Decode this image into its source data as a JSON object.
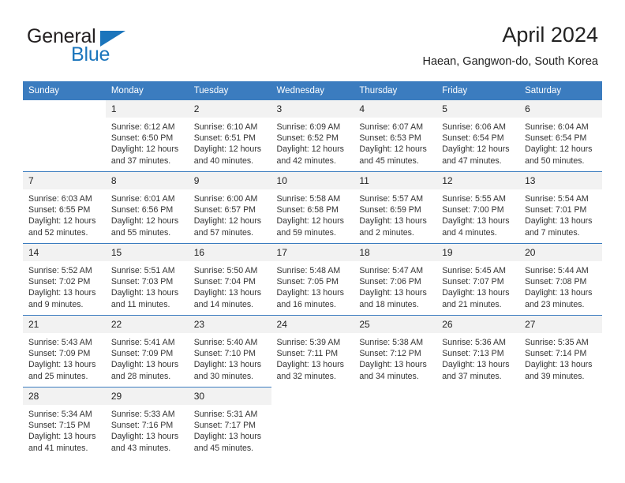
{
  "brand": {
    "name_part1": "General",
    "name_part2": "Blue",
    "flag_icon": "triangle-flag-icon"
  },
  "header": {
    "title": "April 2024",
    "location": "Haean, Gangwon-do, South Korea"
  },
  "colors": {
    "header_blue": "#3b7cbf",
    "brand_blue": "#1b75bc",
    "daynum_bg": "#f2f2f2",
    "text": "#222222"
  },
  "weekday_headers": [
    "Sunday",
    "Monday",
    "Tuesday",
    "Wednesday",
    "Thursday",
    "Friday",
    "Saturday"
  ],
  "labels": {
    "sunrise": "Sunrise:",
    "sunset": "Sunset:",
    "daylight": "Daylight:"
  },
  "weeks": [
    {
      "days": [
        {
          "num": "",
          "blank": true,
          "sunrise": "",
          "sunset": "",
          "daylight_line1": "",
          "daylight_line2": ""
        },
        {
          "num": "1",
          "sunrise": "Sunrise: 6:12 AM",
          "sunset": "Sunset: 6:50 PM",
          "daylight_line1": "Daylight: 12 hours",
          "daylight_line2": "and 37 minutes."
        },
        {
          "num": "2",
          "sunrise": "Sunrise: 6:10 AM",
          "sunset": "Sunset: 6:51 PM",
          "daylight_line1": "Daylight: 12 hours",
          "daylight_line2": "and 40 minutes."
        },
        {
          "num": "3",
          "sunrise": "Sunrise: 6:09 AM",
          "sunset": "Sunset: 6:52 PM",
          "daylight_line1": "Daylight: 12 hours",
          "daylight_line2": "and 42 minutes."
        },
        {
          "num": "4",
          "sunrise": "Sunrise: 6:07 AM",
          "sunset": "Sunset: 6:53 PM",
          "daylight_line1": "Daylight: 12 hours",
          "daylight_line2": "and 45 minutes."
        },
        {
          "num": "5",
          "sunrise": "Sunrise: 6:06 AM",
          "sunset": "Sunset: 6:54 PM",
          "daylight_line1": "Daylight: 12 hours",
          "daylight_line2": "and 47 minutes."
        },
        {
          "num": "6",
          "sunrise": "Sunrise: 6:04 AM",
          "sunset": "Sunset: 6:54 PM",
          "daylight_line1": "Daylight: 12 hours",
          "daylight_line2": "and 50 minutes."
        }
      ]
    },
    {
      "days": [
        {
          "num": "7",
          "sunrise": "Sunrise: 6:03 AM",
          "sunset": "Sunset: 6:55 PM",
          "daylight_line1": "Daylight: 12 hours",
          "daylight_line2": "and 52 minutes."
        },
        {
          "num": "8",
          "sunrise": "Sunrise: 6:01 AM",
          "sunset": "Sunset: 6:56 PM",
          "daylight_line1": "Daylight: 12 hours",
          "daylight_line2": "and 55 minutes."
        },
        {
          "num": "9",
          "sunrise": "Sunrise: 6:00 AM",
          "sunset": "Sunset: 6:57 PM",
          "daylight_line1": "Daylight: 12 hours",
          "daylight_line2": "and 57 minutes."
        },
        {
          "num": "10",
          "sunrise": "Sunrise: 5:58 AM",
          "sunset": "Sunset: 6:58 PM",
          "daylight_line1": "Daylight: 12 hours",
          "daylight_line2": "and 59 minutes."
        },
        {
          "num": "11",
          "sunrise": "Sunrise: 5:57 AM",
          "sunset": "Sunset: 6:59 PM",
          "daylight_line1": "Daylight: 13 hours",
          "daylight_line2": "and 2 minutes."
        },
        {
          "num": "12",
          "sunrise": "Sunrise: 5:55 AM",
          "sunset": "Sunset: 7:00 PM",
          "daylight_line1": "Daylight: 13 hours",
          "daylight_line2": "and 4 minutes."
        },
        {
          "num": "13",
          "sunrise": "Sunrise: 5:54 AM",
          "sunset": "Sunset: 7:01 PM",
          "daylight_line1": "Daylight: 13 hours",
          "daylight_line2": "and 7 minutes."
        }
      ]
    },
    {
      "days": [
        {
          "num": "14",
          "sunrise": "Sunrise: 5:52 AM",
          "sunset": "Sunset: 7:02 PM",
          "daylight_line1": "Daylight: 13 hours",
          "daylight_line2": "and 9 minutes."
        },
        {
          "num": "15",
          "sunrise": "Sunrise: 5:51 AM",
          "sunset": "Sunset: 7:03 PM",
          "daylight_line1": "Daylight: 13 hours",
          "daylight_line2": "and 11 minutes."
        },
        {
          "num": "16",
          "sunrise": "Sunrise: 5:50 AM",
          "sunset": "Sunset: 7:04 PM",
          "daylight_line1": "Daylight: 13 hours",
          "daylight_line2": "and 14 minutes."
        },
        {
          "num": "17",
          "sunrise": "Sunrise: 5:48 AM",
          "sunset": "Sunset: 7:05 PM",
          "daylight_line1": "Daylight: 13 hours",
          "daylight_line2": "and 16 minutes."
        },
        {
          "num": "18",
          "sunrise": "Sunrise: 5:47 AM",
          "sunset": "Sunset: 7:06 PM",
          "daylight_line1": "Daylight: 13 hours",
          "daylight_line2": "and 18 minutes."
        },
        {
          "num": "19",
          "sunrise": "Sunrise: 5:45 AM",
          "sunset": "Sunset: 7:07 PM",
          "daylight_line1": "Daylight: 13 hours",
          "daylight_line2": "and 21 minutes."
        },
        {
          "num": "20",
          "sunrise": "Sunrise: 5:44 AM",
          "sunset": "Sunset: 7:08 PM",
          "daylight_line1": "Daylight: 13 hours",
          "daylight_line2": "and 23 minutes."
        }
      ]
    },
    {
      "days": [
        {
          "num": "21",
          "sunrise": "Sunrise: 5:43 AM",
          "sunset": "Sunset: 7:09 PM",
          "daylight_line1": "Daylight: 13 hours",
          "daylight_line2": "and 25 minutes."
        },
        {
          "num": "22",
          "sunrise": "Sunrise: 5:41 AM",
          "sunset": "Sunset: 7:09 PM",
          "daylight_line1": "Daylight: 13 hours",
          "daylight_line2": "and 28 minutes."
        },
        {
          "num": "23",
          "sunrise": "Sunrise: 5:40 AM",
          "sunset": "Sunset: 7:10 PM",
          "daylight_line1": "Daylight: 13 hours",
          "daylight_line2": "and 30 minutes."
        },
        {
          "num": "24",
          "sunrise": "Sunrise: 5:39 AM",
          "sunset": "Sunset: 7:11 PM",
          "daylight_line1": "Daylight: 13 hours",
          "daylight_line2": "and 32 minutes."
        },
        {
          "num": "25",
          "sunrise": "Sunrise: 5:38 AM",
          "sunset": "Sunset: 7:12 PM",
          "daylight_line1": "Daylight: 13 hours",
          "daylight_line2": "and 34 minutes."
        },
        {
          "num": "26",
          "sunrise": "Sunrise: 5:36 AM",
          "sunset": "Sunset: 7:13 PM",
          "daylight_line1": "Daylight: 13 hours",
          "daylight_line2": "and 37 minutes."
        },
        {
          "num": "27",
          "sunrise": "Sunrise: 5:35 AM",
          "sunset": "Sunset: 7:14 PM",
          "daylight_line1": "Daylight: 13 hours",
          "daylight_line2": "and 39 minutes."
        }
      ]
    },
    {
      "days": [
        {
          "num": "28",
          "sunrise": "Sunrise: 5:34 AM",
          "sunset": "Sunset: 7:15 PM",
          "daylight_line1": "Daylight: 13 hours",
          "daylight_line2": "and 41 minutes."
        },
        {
          "num": "29",
          "sunrise": "Sunrise: 5:33 AM",
          "sunset": "Sunset: 7:16 PM",
          "daylight_line1": "Daylight: 13 hours",
          "daylight_line2": "and 43 minutes."
        },
        {
          "num": "30",
          "sunrise": "Sunrise: 5:31 AM",
          "sunset": "Sunset: 7:17 PM",
          "daylight_line1": "Daylight: 13 hours",
          "daylight_line2": "and 45 minutes."
        },
        {
          "num": "",
          "blank": true,
          "sunrise": "",
          "sunset": "",
          "daylight_line1": "",
          "daylight_line2": ""
        },
        {
          "num": "",
          "blank": true,
          "sunrise": "",
          "sunset": "",
          "daylight_line1": "",
          "daylight_line2": ""
        },
        {
          "num": "",
          "blank": true,
          "sunrise": "",
          "sunset": "",
          "daylight_line1": "",
          "daylight_line2": ""
        },
        {
          "num": "",
          "blank": true,
          "sunrise": "",
          "sunset": "",
          "daylight_line1": "",
          "daylight_line2": ""
        }
      ]
    }
  ]
}
